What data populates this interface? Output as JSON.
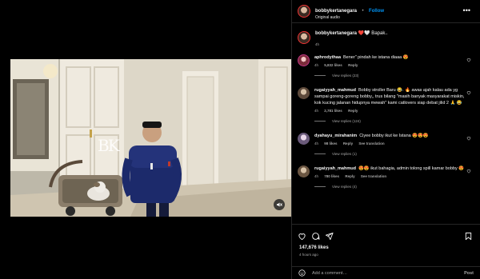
{
  "post": {
    "username": "bobbykertanegara",
    "follow_label": "Follow",
    "audio": "Original audio",
    "more_label": "•••",
    "watermark": "BK"
  },
  "caption": {
    "username": "bobbykertanegara",
    "text": "❤️🤍 Bapak..",
    "time": "4h"
  },
  "comments": [
    {
      "username": "aphrodythaa",
      "text": "Bener\" pindah ke istana diaaa 😍",
      "time": "4h",
      "likes": "5,832 likes",
      "reply": "Reply",
      "see_translation": "",
      "view_replies": "View replies (23)"
    },
    {
      "username": "rugaiyyah_mahmud",
      "text": "Bobby stroller Baru 😂. 🔥 awas ajah kalau ada yg sampai goreng-goreng bobby,, trus bilang \"masih banyak masyarakat miskin, kok kucing jalanan hidupnya mewah\" kami catlovers siap debat jilid 2 🙏 😂",
      "time": "4h",
      "likes": "2,781 likes",
      "reply": "Reply",
      "see_translation": "",
      "view_replies": "View replies (124)"
    },
    {
      "username": "dyahayu_mirahanim",
      "text": "Ciyee bobby ikut ke Istana 😍😍😍",
      "time": "4h",
      "likes": "98 likes",
      "reply": "Reply",
      "see_translation": "See translation",
      "view_replies": "View replies (1)"
    },
    {
      "username": "rugaiyyah_mahmud",
      "text": "😍😍 ikut bahagia, admin tolong spill kamar bobby 😍",
      "time": "4h",
      "likes": "780 likes",
      "reply": "Reply",
      "see_translation": "See translation",
      "view_replies": "View replies (4)"
    }
  ],
  "footer": {
    "likes": "147,676 likes",
    "time_ago": "4 hours ago",
    "add_comment_placeholder": "Add a comment…",
    "post_label": "Post"
  },
  "icons": {
    "like": "heart-icon",
    "comment": "comment-icon",
    "share": "share-icon",
    "save": "bookmark-icon",
    "emoji": "emoji-icon",
    "mute": "mute-icon"
  },
  "colors": {
    "background": "#000000",
    "accent": "#0095f6",
    "muted_text": "#a8a8a8",
    "divider": "#262626"
  }
}
